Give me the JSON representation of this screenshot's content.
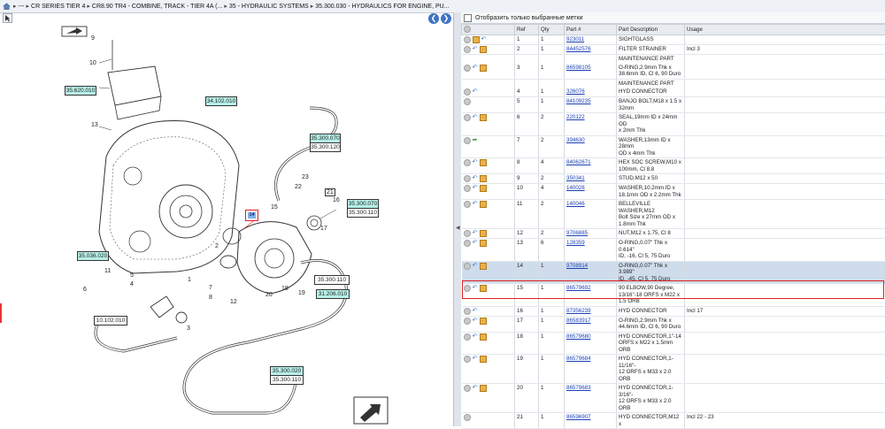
{
  "breadcrumb": {
    "items": [
      "---",
      "CR SERIES TIER 4",
      "CR8.90 TR4 - COMBINE, TRACK - TIER 4A (...",
      "35 - HYDRAULIC SYSTEMS",
      "35.300.030 - HYDRAULICS FOR ENGINE, PU..."
    ],
    "separator": "▸"
  },
  "filter": {
    "label": "Отобразить только выбранные метки",
    "checked": false
  },
  "table": {
    "headers": [
      "",
      "Ref",
      "Qty",
      "Part #",
      "Part Description",
      "Usage"
    ],
    "rows": [
      {
        "ref": "1",
        "qty": "1",
        "part": "923011",
        "desc": [
          "SIGHTGLASS"
        ],
        "usage": "",
        "icons": [
          "circ",
          "box",
          "arrow"
        ]
      },
      {
        "ref": "2",
        "qty": "1",
        "part": "84452576",
        "desc": [
          "FILTER STRAINER"
        ],
        "usage": "Incl 3",
        "icons": [
          "circ",
          "arrow",
          "box"
        ]
      },
      {
        "note": "MAINTENANCE PART"
      },
      {
        "ref": "3",
        "qty": "1",
        "part": "86598105",
        "desc": [
          "O-RING,2.9mm Thk x",
          "38.6mm ID, Cl 6, 90 Duro"
        ],
        "usage": "",
        "icons": [
          "circ",
          "arrow",
          "box"
        ]
      },
      {
        "note": "MAINTENANCE PART"
      },
      {
        "ref": "4",
        "qty": "1",
        "part": "326076",
        "desc": [
          "HYD CONNECTOR"
        ],
        "usage": "",
        "icons": [
          "circ",
          "arrow"
        ]
      },
      {
        "ref": "5",
        "qty": "1",
        "part": "84109235",
        "desc": [
          "BANJO BOLT,M18 x 1.5 x",
          "32mm"
        ],
        "usage": "",
        "icons": [
          "circ"
        ]
      },
      {
        "ref": "6",
        "qty": "2",
        "part": "220122",
        "desc": [
          "SEAL,19mm ID x 24mm OD",
          "x 2mm Thk"
        ],
        "usage": "",
        "icons": [
          "circ",
          "arrow",
          "box"
        ]
      },
      {
        "ref": "7",
        "qty": "2",
        "part": "394630",
        "desc": [
          "WASHER,13mm ID x 28mm",
          "OD x 4mm Thk"
        ],
        "usage": "",
        "icons": [
          "circ",
          "green"
        ]
      },
      {
        "ref": "8",
        "qty": "4",
        "part": "84062671",
        "desc": [
          "HEX SOC SCREW,M10 x",
          "100mm, Cl 8.8"
        ],
        "usage": "",
        "icons": [
          "circ",
          "arrow",
          "box"
        ]
      },
      {
        "ref": "9",
        "qty": "2",
        "part": "350341",
        "desc": [
          "STUD,M12 x 50"
        ],
        "usage": "",
        "icons": [
          "circ",
          "arrow",
          "box"
        ]
      },
      {
        "ref": "10",
        "qty": "4",
        "part": "140028",
        "desc": [
          "WASHER,10.2mm ID x",
          "18.1mm OD x 2.2mm Thk"
        ],
        "usage": "",
        "icons": [
          "circ",
          "arrow",
          "box"
        ]
      },
      {
        "ref": "11",
        "qty": "2",
        "part": "140046",
        "desc": [
          "BELLEVILLE WASHER,M12",
          "Bolt Size x 27mm OD x",
          "1.8mm Thk"
        ],
        "usage": "",
        "icons": [
          "circ",
          "arrow",
          "box"
        ]
      },
      {
        "ref": "12",
        "qty": "2",
        "part": "9706885",
        "desc": [
          "NUT,M12 x 1.75, Cl 8"
        ],
        "usage": "",
        "icons": [
          "circ",
          "arrow",
          "box"
        ]
      },
      {
        "ref": "13",
        "qty": "6",
        "part": "128359",
        "desc": [
          "O-RING,0.07\" Thk x 0.614\"",
          "ID, -16, Cl 5, 75 Duro"
        ],
        "usage": "",
        "icons": [
          "circ",
          "arrow",
          "box"
        ]
      },
      {
        "ref": "14",
        "qty": "1",
        "part": "9708914",
        "desc": [
          "O-RING,0.07\" Thk x 3.989\"",
          "ID, -45, Cl 5, 75 Duro"
        ],
        "usage": "",
        "icons": [
          "circ",
          "arrow",
          "box"
        ],
        "selected": true
      },
      {
        "ref": "15",
        "qty": "1",
        "part": "86579692",
        "desc": [
          "90 ELBOW,90 Degree,",
          "13/16\"-18 ORFS x M22 x",
          "1.5 ORB"
        ],
        "usage": "",
        "icons": [
          "circ",
          "arrow",
          "box"
        ]
      },
      {
        "ref": "16",
        "qty": "1",
        "part": "87356239",
        "desc": [
          "HYD CONNECTOR"
        ],
        "usage": "Incl 17",
        "icons": [
          "circ",
          "arrow"
        ]
      },
      {
        "ref": "17",
        "qty": "1",
        "part": "86583917",
        "desc": [
          "O-RING,2.9mm Thk x",
          "44.6mm ID, Cl 6, 90 Duro"
        ],
        "usage": "",
        "icons": [
          "circ",
          "arrow",
          "box"
        ]
      },
      {
        "ref": "18",
        "qty": "1",
        "part": "86579680",
        "desc": [
          "HYD CONNECTOR,1\"-14",
          "ORFS x M22 x 1.5mm ORB"
        ],
        "usage": "",
        "icons": [
          "circ",
          "arrow",
          "box"
        ]
      },
      {
        "ref": "19",
        "qty": "1",
        "part": "86579684",
        "desc": [
          "HYD CONNECTOR,1-11/16\"-",
          "12 ORFS x M33 x 2.0 ORB"
        ],
        "usage": "",
        "icons": [
          "circ",
          "arrow",
          "box"
        ]
      },
      {
        "ref": "20",
        "qty": "1",
        "part": "86579683",
        "desc": [
          "HYD CONNECTOR,1-3/16\"-",
          "12 ORFS x M33 x 2.0 ORB"
        ],
        "usage": "",
        "icons": [
          "circ",
          "arrow",
          "box"
        ]
      },
      {
        "ref": "21",
        "qty": "1",
        "part": "86596907",
        "desc": [
          "HYD CONNECTOR,M12 x"
        ],
        "usage": "Incl 22 - 23",
        "icons": [
          "circ"
        ]
      }
    ]
  },
  "diagram": {
    "section_refs": [
      "35.620.010",
      "34.102.010",
      "35.300.070",
      "35.300.120",
      "35.300.070",
      "35.300.110",
      "35.036.020",
      "35.300.110",
      "31.206.010",
      "10.102.010",
      "35.300.020",
      "35.300.110"
    ],
    "highlighted_callout": "14",
    "callouts": [
      "9",
      "10",
      "13",
      "16",
      "15",
      "22",
      "23",
      "21",
      "17",
      "19",
      "20",
      "18",
      "7",
      "8",
      "1",
      "5",
      "4",
      "6",
      "3",
      "12",
      "11",
      "2"
    ]
  },
  "colors": {
    "accent": "#3f73c2",
    "selection": "#cfdcec",
    "highlight_outline": "#e02020",
    "section_ref_fill": "#b6f0e8"
  }
}
